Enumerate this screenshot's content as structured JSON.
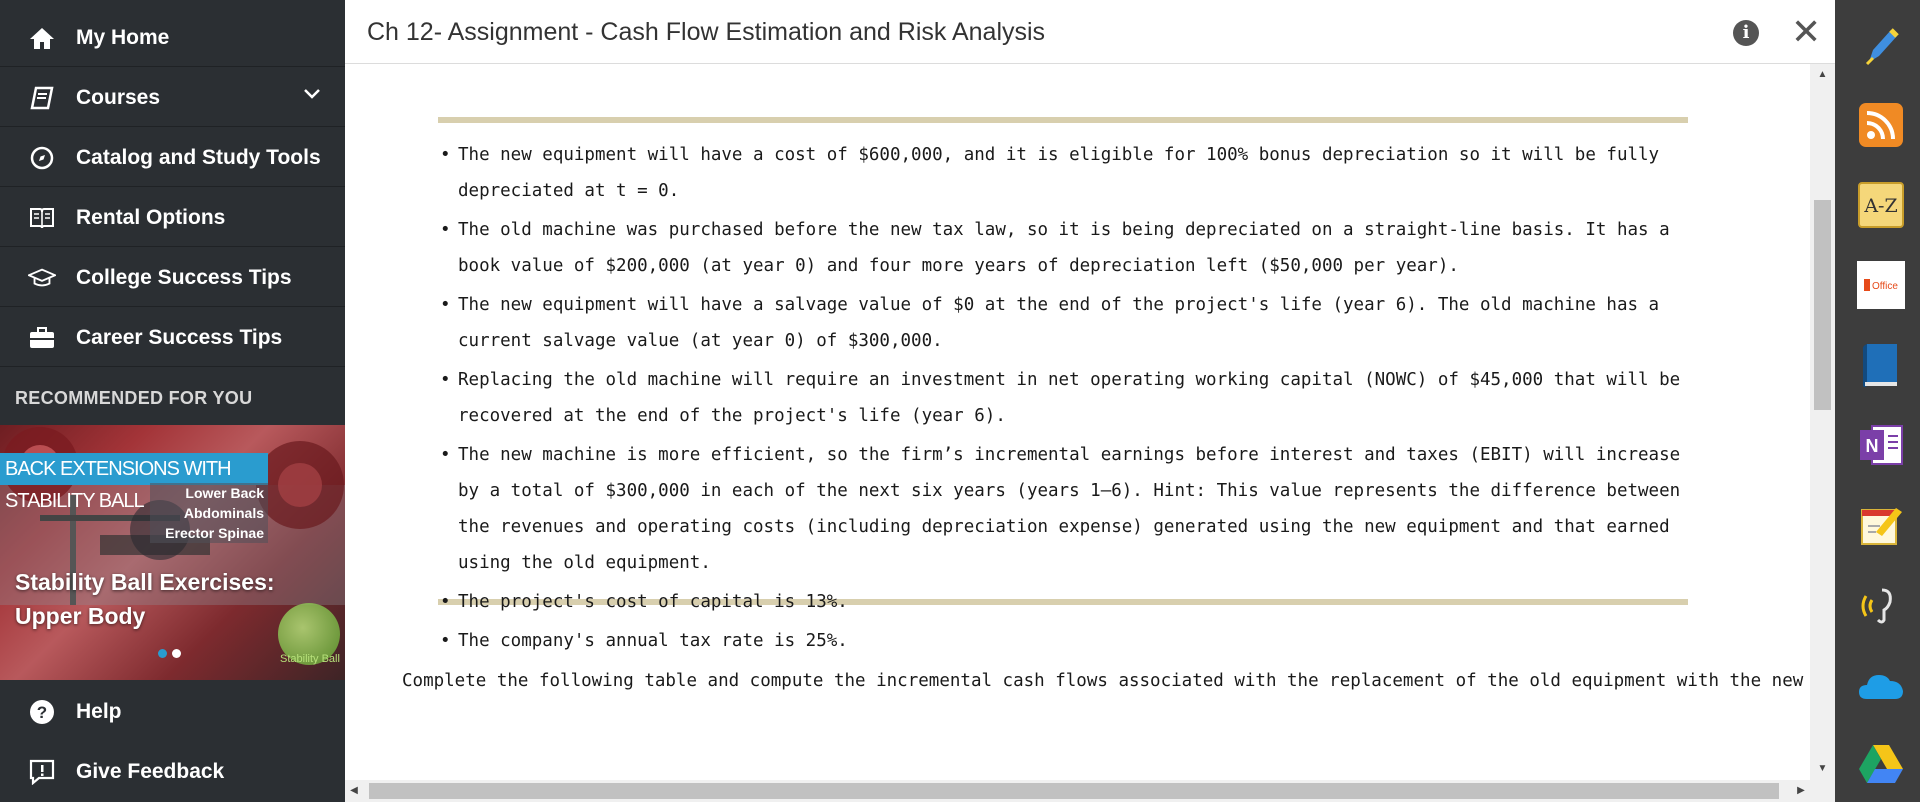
{
  "sidebar": {
    "items": [
      {
        "label": "My Home",
        "icon": "home-icon"
      },
      {
        "label": "Courses",
        "icon": "book-icon"
      },
      {
        "label": "Catalog and Study Tools",
        "icon": "compass-icon"
      },
      {
        "label": "Rental Options",
        "icon": "open-book-icon"
      },
      {
        "label": "College Success Tips",
        "icon": "graduation-cap-icon"
      },
      {
        "label": "Career Success Tips",
        "icon": "briefcase-icon"
      }
    ],
    "recommended_title": "RECOMMENDED FOR YOU",
    "promo": {
      "banner": "BACK EXTENSIONS WITH STABILITY BALL",
      "muscles": [
        "Lower Back",
        "Abdominals",
        "Erector Spinae"
      ],
      "caption": "Stability Ball Exercises: Upper Body",
      "ball_label": "Stability Ball",
      "slide_count": 2,
      "active_slide": 1
    },
    "bottom_items": [
      {
        "label": "Help",
        "icon": "question-icon"
      },
      {
        "label": "Give Feedback",
        "icon": "feedback-icon"
      }
    ]
  },
  "header": {
    "title": "Ch 12- Assignment - Cash Flow Estimation and Risk Analysis",
    "info_icon": "i",
    "close_icon": "✕"
  },
  "content": {
    "bullets": [
      "The new equipment will have a cost of $600,000, and it is eligible for 100% bonus depreciation so it will be fully depreciated at t = 0.",
      "The old machine was purchased before the new tax law, so it is being depreciated on a straight-line basis. It has a book value of $200,000 (at year 0) and four more years of depreciation left ($50,000 per year).",
      "The new equipment will have a salvage value of $0 at the end of the project's life (year 6). The old machine has a current salvage value (at year 0) of $300,000.",
      "Replacing the old machine will require an investment in net operating working capital (NOWC) of $45,000 that will be recovered at the end of the project's life (year 6).",
      "The new machine is more efficient, so the firm’s incremental earnings before interest and taxes (EBIT) will increase by a total of $300,000 in each of the next six years (years 1–6). Hint: This value represents the difference between the revenues and operating costs (including depreciation expense) generated using the new equipment and that earned using the old equipment.",
      "The project's cost of capital is 13%.",
      "The company's annual tax rate is 25%."
    ],
    "instruction": "Complete the following table and compute the incremental cash flows associated with the replacement of the old equipment with the new equipment."
  },
  "toolbar": {
    "tools": [
      "highlighter-icon",
      "rss-icon",
      "a-z-glossary-icon",
      "office-icon",
      "ebook-icon",
      "onenote-icon",
      "notepad-icon",
      "read-aloud-icon",
      "onedrive-icon",
      "google-drive-icon"
    ],
    "az_label": "A-Z",
    "office_label": "Office",
    "onenote_label": "N"
  },
  "colors": {
    "sidebar_bg": "#2b2f33",
    "accent_blue": "#2a9ccf",
    "box_border": "#d8cfae",
    "toolbar_bg": "#3d3d3d"
  }
}
